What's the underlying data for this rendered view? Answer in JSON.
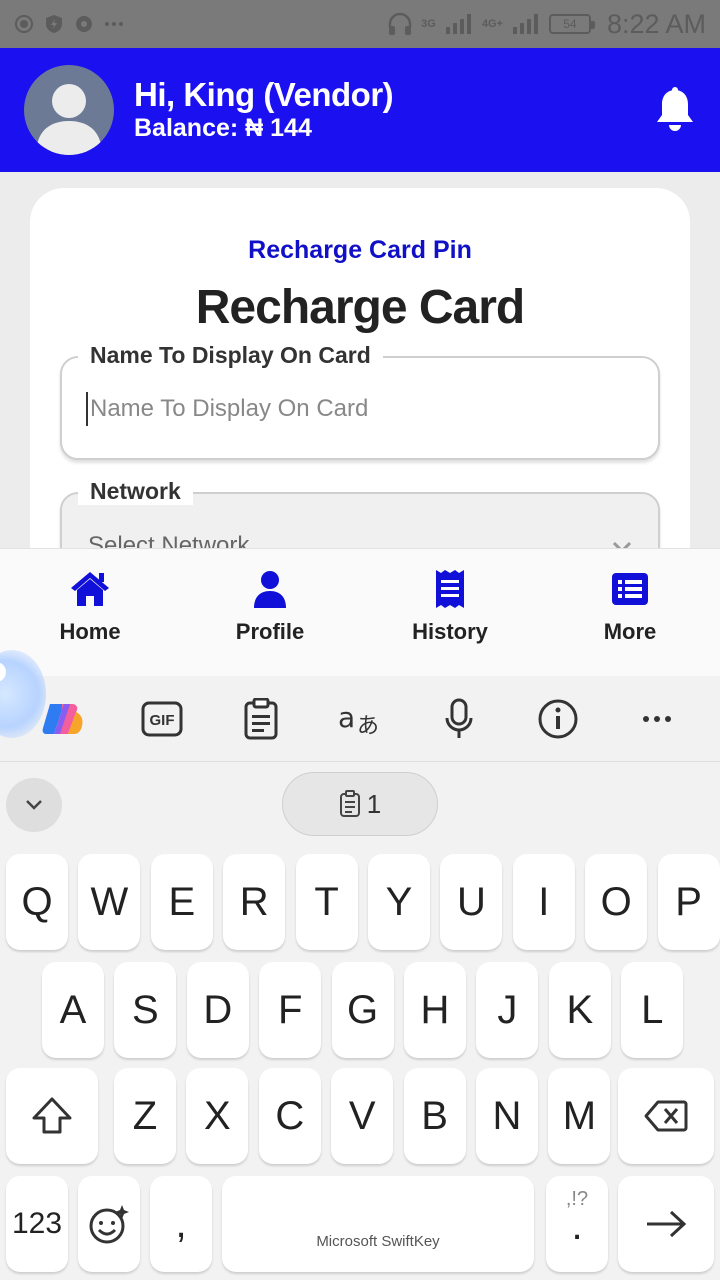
{
  "statusbar": {
    "network1": "3G",
    "network2": "4G+",
    "battery": "54",
    "time": "8:22 AM"
  },
  "header": {
    "greeting": "Hi, King (Vendor)",
    "balance": "Balance: ₦ 144"
  },
  "card": {
    "subtitle": "Recharge Card Pin",
    "title": "Recharge Card",
    "name_field": {
      "legend": "Name To Display On Card",
      "placeholder": "Name To Display On Card",
      "value": ""
    },
    "network_field": {
      "legend": "Network",
      "selected": "Select Network"
    }
  },
  "nav": {
    "items": [
      {
        "label": "Home",
        "icon": "home-icon"
      },
      {
        "label": "Profile",
        "icon": "user-icon"
      },
      {
        "label": "History",
        "icon": "receipt-icon"
      },
      {
        "label": "More",
        "icon": "list-icon"
      }
    ]
  },
  "keyboard": {
    "clipboard_count": "1",
    "row1": [
      "Q",
      "W",
      "E",
      "R",
      "T",
      "Y",
      "U",
      "I",
      "O",
      "P"
    ],
    "row2": [
      "A",
      "S",
      "D",
      "F",
      "G",
      "H",
      "J",
      "K",
      "L"
    ],
    "row3": [
      "Z",
      "X",
      "C",
      "V",
      "B",
      "N",
      "M"
    ],
    "numbers_key": "123",
    "comma_key": ",",
    "spacebar_label": "Microsoft SwiftKey",
    "punct_top": ",!?",
    "period_key": "."
  },
  "colors": {
    "primary": "#1a10f0",
    "accent_text": "#1010c8"
  }
}
